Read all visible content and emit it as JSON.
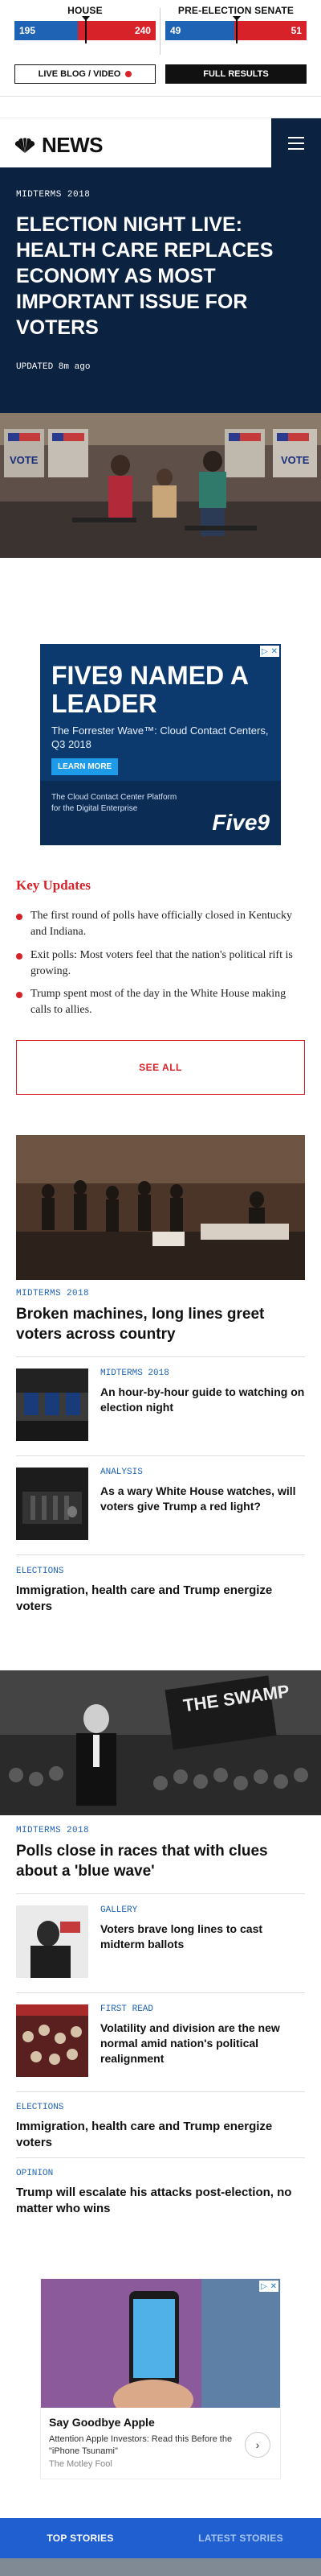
{
  "results": {
    "house": {
      "title": "HOUSE",
      "dem": "195",
      "rep": "240",
      "dem_share": 0.45,
      "rep_share": 0.55
    },
    "senate": {
      "title": "PRE-ELECTION SENATE",
      "dem": "49",
      "rep": "51",
      "dem_share": 0.49,
      "rep_share": 0.51
    },
    "live_label": "LIVE BLOG / VIDEO",
    "full_label": "FULL RESULTS"
  },
  "header": {
    "logo_text": "NEWS",
    "logo_icon": "nbc-peacock-icon",
    "menu_icon": "hamburger-menu-icon"
  },
  "hero": {
    "eyebrow": "MIDTERMS 2018",
    "title": "ELECTION NIGHT LIVE: HEALTH CARE REPLACES ECONOMY AS MOST IMPORTANT ISSUE FOR VOTERS",
    "updated": "UPDATED 8m ago"
  },
  "ad1": {
    "headline": "FIVE9 NAMED A LEADER",
    "sub": "The Forrester Wave™: Cloud Contact Centers, Q3 2018",
    "button": "LEARN MORE",
    "bottom_text": "The Cloud Contact Center Platform for the Digital Enterprise",
    "brand": "Five9",
    "close": "✕"
  },
  "key_updates": {
    "title": "Key Updates",
    "items": [
      "The first round of polls have officially closed in Kentucky and Indiana.",
      "Exit polls: Most voters feel that the nation's political rift is growing.",
      "Trump spent most of the day in the White House making calls to allies."
    ],
    "see_all": "SEE ALL"
  },
  "feed": {
    "lead1": {
      "eyebrow": "MIDTERMS 2018",
      "title": "Broken machines, long lines greet voters across country"
    },
    "row1": {
      "eyebrow": "MIDTERMS 2018",
      "title": "An hour-by-hour guide to watching on election night"
    },
    "row2": {
      "eyebrow": "ANALYSIS",
      "title": "As a wary White House watches, will voters give Trump a red light?"
    },
    "text1": {
      "eyebrow": "ELECTIONS",
      "title": "Immigration, health care and Trump energize voters"
    },
    "lead2": {
      "eyebrow": "MIDTERMS 2018",
      "title": "Polls close in races that with clues about a 'blue wave'",
      "sign_text": "THE SWAMP"
    },
    "row3": {
      "eyebrow": "GALLERY",
      "title": "Voters brave long lines to cast midterm ballots"
    },
    "row4": {
      "eyebrow": "FIRST READ",
      "title": "Volatility and division are the new normal amid nation's political realignment"
    },
    "text2": {
      "eyebrow": "ELECTIONS",
      "title": "Immigration, health care and Trump energize voters"
    },
    "text3": {
      "eyebrow": "OPINION",
      "title": "Trump will escalate his attacks post-election, no matter who wins"
    }
  },
  "ad2": {
    "headline": "Say Goodbye Apple",
    "sub": "Attention Apple Investors: Read this Before the \"iPhone Tsunami\"",
    "source": "The Motley Fool",
    "arrow": "›",
    "close": "✕"
  },
  "tabs": {
    "top": "TOP STORIES",
    "latest": "LATEST STORIES"
  }
}
